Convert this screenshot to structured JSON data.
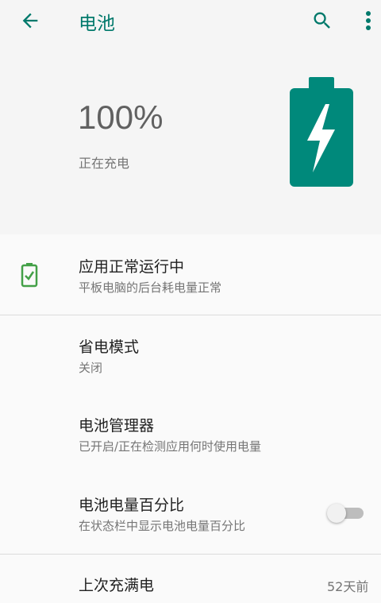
{
  "appbar": {
    "title": "电池",
    "back_icon": "arrow-back-icon",
    "search_icon": "search-icon",
    "more_icon": "more-vert-icon"
  },
  "header": {
    "percent": "100%",
    "status": "正在充电",
    "battery_icon": "battery-charging-icon"
  },
  "items": [
    {
      "title": "应用正常运行中",
      "subtitle": "平板电脑的后台耗电量正常",
      "icon": "battery-check-icon"
    },
    {
      "title": "省电模式",
      "subtitle": "关闭"
    },
    {
      "title": "电池管理器",
      "subtitle": "已开启/正在检测应用何时使用电量"
    },
    {
      "title": "电池电量百分比",
      "subtitle": "在状态栏中显示电池电量百分比",
      "toggle_on": false
    },
    {
      "title": "上次充满电",
      "value": "52天前"
    }
  ],
  "colors": {
    "accent": "#00796b",
    "icon_green": "#43a047"
  }
}
